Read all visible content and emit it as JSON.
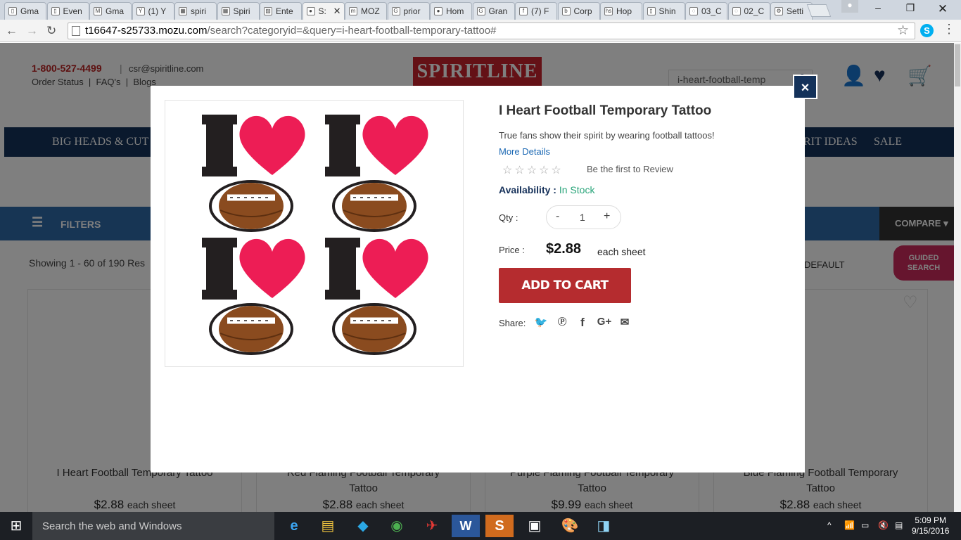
{
  "browser": {
    "tabs": [
      {
        "title": "Gma",
        "icon": "doc"
      },
      {
        "title": "Even",
        "icon": "doc"
      },
      {
        "title": "Gma",
        "icon": "M"
      },
      {
        "title": "(1) Y",
        "icon": "Y"
      },
      {
        "title": "spiri",
        "icon": "sheet"
      },
      {
        "title": "Spiri",
        "icon": "sheet"
      },
      {
        "title": "Ente",
        "icon": "img"
      },
      {
        "title": "S:",
        "icon": "pin",
        "active": true
      },
      {
        "title": "MOZ",
        "icon": "m"
      },
      {
        "title": "prior",
        "icon": "G"
      },
      {
        "title": "Hom",
        "icon": "pin"
      },
      {
        "title": "Gran",
        "icon": "G"
      },
      {
        "title": "(7) F",
        "icon": "f"
      },
      {
        "title": "Corp",
        "icon": "b"
      },
      {
        "title": "Hop",
        "icon": "hs"
      },
      {
        "title": "Shin",
        "icon": "doc"
      },
      {
        "title": "03_C",
        "icon": "spin"
      },
      {
        "title": "02_C",
        "icon": "spin"
      },
      {
        "title": "Setti",
        "icon": "gear"
      }
    ],
    "url_host": "t16647-s25733.mozu.com",
    "url_path": "/search?categoryid=&query=i-heart-football-temporary-tattoo#"
  },
  "site": {
    "phone": "1-800-527-4499",
    "email": "csr@spiritline.com",
    "links": "Order Status  |  FAQ's  |  Blogs",
    "logo": "SPIRITLINE",
    "search_value": "i-heart-football-temp",
    "nav_left": "BIG HEADS & CUT",
    "nav_right_1": "RIT IDEAS",
    "nav_right_2": "SALE",
    "filters_label": "FILTERS",
    "compare_label": "COMPARE",
    "showing": "Showing 1 - 60 of 190 Res",
    "sort_label": "DEFAULT",
    "guided_search": "GUIDED SEARCH",
    "products": [
      {
        "name": "I Heart Football Temporary Tattoo",
        "price": "$2.88",
        "unit": "each sheet"
      },
      {
        "name": "Red Flaming Football Temporary Tattoo",
        "price": "$2.88",
        "unit": "each sheet"
      },
      {
        "name": "Purple Flaming Football Temporary Tattoo",
        "price": "$9.99",
        "unit": "each sheet"
      },
      {
        "name": "Blue Flaming Football Temporary Tattoo",
        "price": "$2.88",
        "unit": "each sheet"
      }
    ]
  },
  "modal": {
    "title": "I Heart Football Temporary Tattoo",
    "description": "True fans show their spirit by wearing football tattoos!",
    "more_details": "More Details",
    "review_prompt": "Be the first to Review",
    "rating_stars": 0,
    "availability_label": "Availability",
    "availability_value": "In Stock",
    "qty_label": "Qty :",
    "qty_value": "1",
    "qty_minus": "-",
    "qty_plus": "+",
    "price_label": "Price :",
    "price": "$2.88",
    "price_unit": "each sheet",
    "add_to_cart": "ADD TO CART",
    "share_label": "Share:",
    "share_icons": [
      "twitter-icon",
      "pinterest-icon",
      "facebook-icon",
      "google-plus-icon",
      "email-icon"
    ],
    "close": "×",
    "image_text": "I"
  },
  "taskbar": {
    "search_placeholder": "Search the web and Windows",
    "time": "5:09 PM",
    "date": "9/15/2016"
  },
  "colors": {
    "navy": "#14325a",
    "red": "#b52c2f",
    "heart": "#ed1d55",
    "in_stock": "#2aa57a",
    "link": "#1a67b3"
  }
}
